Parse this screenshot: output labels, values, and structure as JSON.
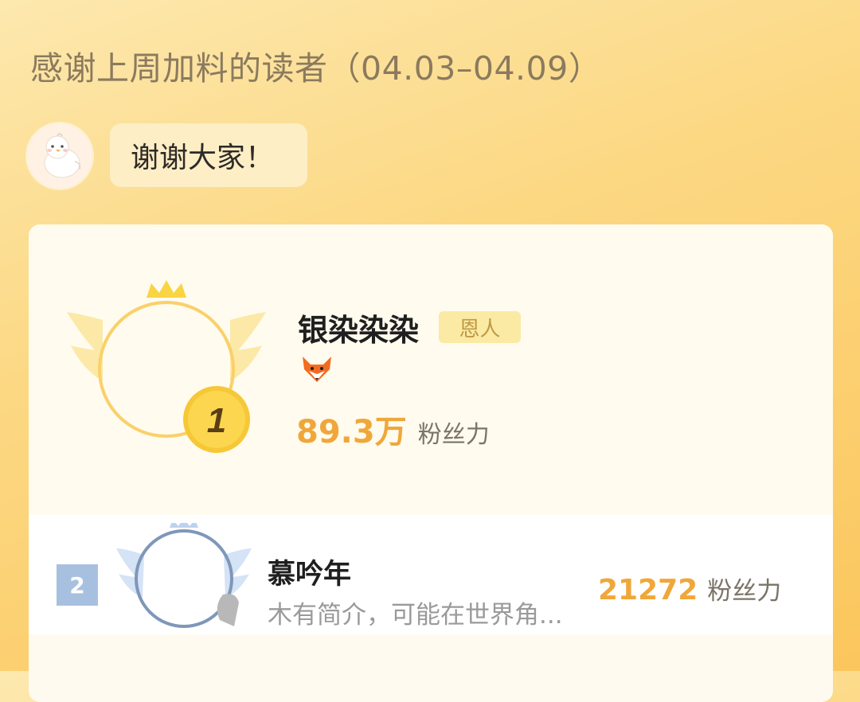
{
  "header": {
    "title": "感谢上周加料的读者（04.03–04.09）"
  },
  "greeting": {
    "message": "谢谢大家！",
    "avatar_icon": "chick-icon"
  },
  "ranking": {
    "first": {
      "rank": "1",
      "name": "银染染染",
      "tag": "恩人",
      "badge_icon": "fox-icon",
      "fans_value": "89.3万",
      "fans_unit": "粉丝力"
    },
    "second": {
      "rank": "2",
      "name": "慕吟年",
      "description": "木有简介，可能在世界角...",
      "fans_value": "21272",
      "fans_unit": "粉丝力"
    }
  },
  "colors": {
    "accent": "#f0a73a",
    "gold": "#f5c842",
    "silver": "#a8c0e0"
  }
}
